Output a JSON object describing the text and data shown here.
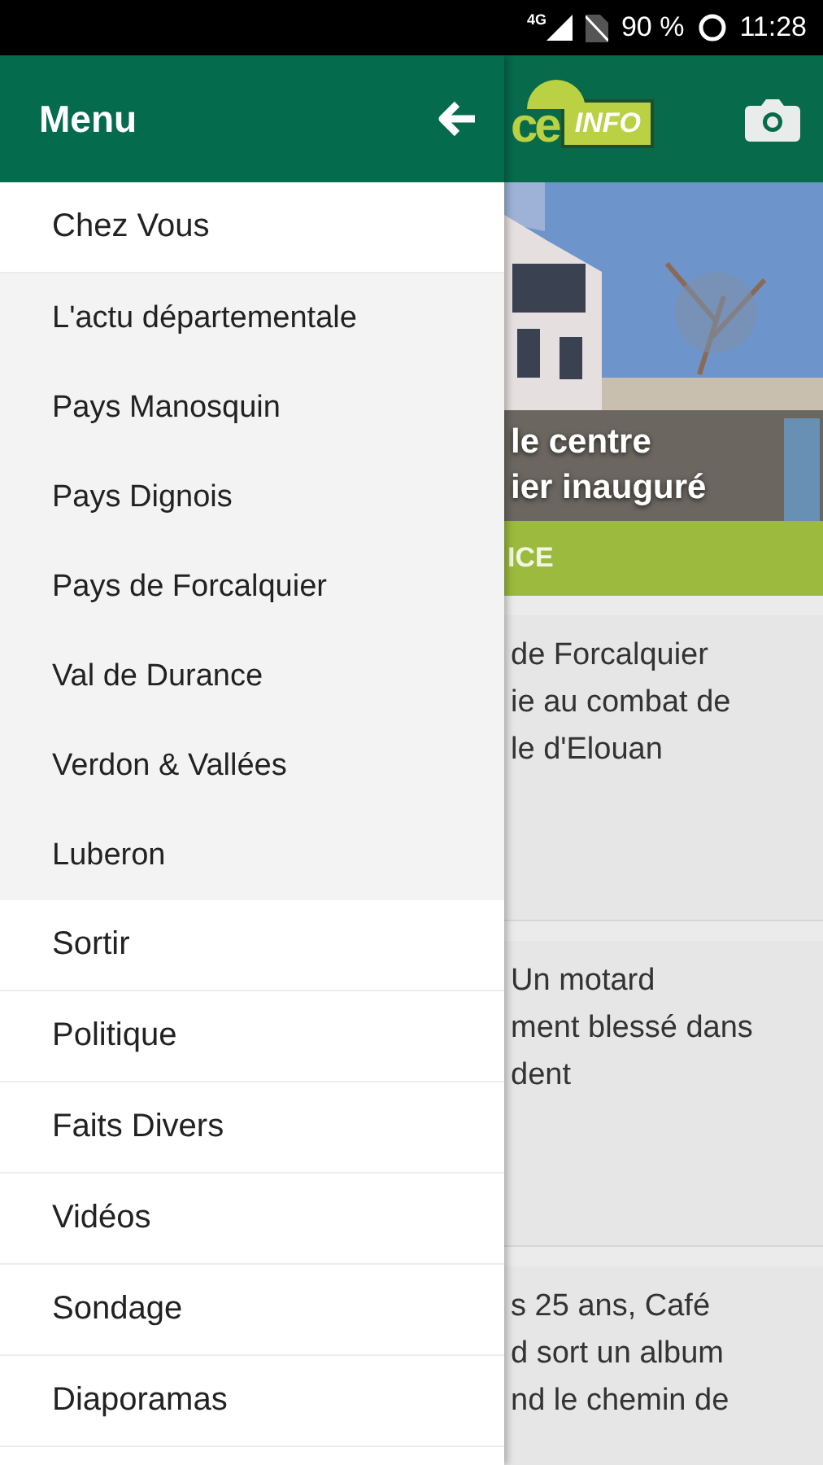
{
  "status_bar": {
    "network": "4G",
    "battery": "90 %",
    "time": "11:28"
  },
  "drawer": {
    "title": "Menu",
    "items": [
      {
        "label": "Chez Vous",
        "kind": "top"
      },
      {
        "label": "L'actu départementale",
        "kind": "sub"
      },
      {
        "label": "Pays Manosquin",
        "kind": "sub"
      },
      {
        "label": "Pays Dignois",
        "kind": "sub"
      },
      {
        "label": "Pays de Forcalquier",
        "kind": "sub"
      },
      {
        "label": "Val de Durance",
        "kind": "sub"
      },
      {
        "label": "Verdon & Vallées",
        "kind": "sub"
      },
      {
        "label": "Luberon",
        "kind": "sub"
      },
      {
        "label": "Sortir",
        "kind": "top"
      },
      {
        "label": "Politique",
        "kind": "top"
      },
      {
        "label": "Faits Divers",
        "kind": "top"
      },
      {
        "label": "Vidéos",
        "kind": "top"
      },
      {
        "label": "Sondage",
        "kind": "top"
      },
      {
        "label": "Diaporamas",
        "kind": "top"
      }
    ]
  },
  "app_bar": {
    "logo": [
      "ce",
      "INFO"
    ]
  },
  "hero": {
    "kind": "picture",
    "headline": [
      "le centre",
      "ier inauguré"
    ],
    "category": "ICE"
  },
  "articles": [
    {
      "lines": [
        "de Forcalquier",
        "ie au combat de",
        "le d'Elouan"
      ]
    },
    {
      "lines": [
        "Un motard",
        "ment blessé dans",
        "dent"
      ]
    },
    {
      "lines": [
        "s 25 ans, Café",
        "d sort un album",
        "nd le chemin de"
      ]
    }
  ]
}
